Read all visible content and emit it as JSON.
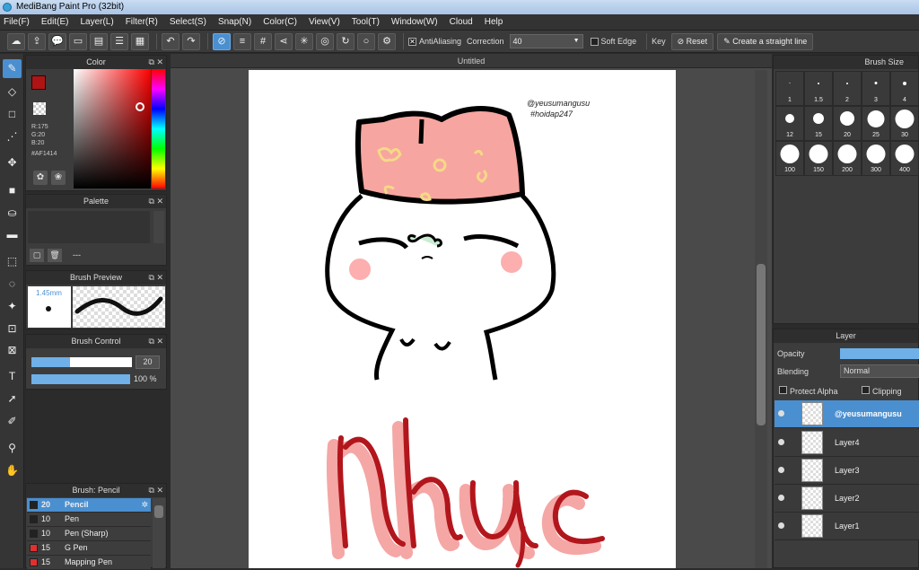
{
  "window": {
    "title": "MediBang Paint Pro (32bit)"
  },
  "menu": [
    "File(F)",
    "Edit(E)",
    "Layer(L)",
    "Filter(R)",
    "Select(S)",
    "Snap(N)",
    "Color(C)",
    "View(V)",
    "Tool(T)",
    "Window(W)",
    "Cloud",
    "Help"
  ],
  "toolbar": {
    "antialiasing_label": "AntiAliasing",
    "correction_label": "Correction",
    "correction_value": "40",
    "softedge_label": "Soft Edge",
    "key_label": "Key",
    "reset_label": "Reset",
    "straight_line_label": "Create a straight line"
  },
  "color_panel": {
    "title": "Color",
    "r": "R:175",
    "g": "G:20",
    "b": "B:20",
    "hex": "#AF1414",
    "fg_color": "#AF1414"
  },
  "palette_panel": {
    "title": "Palette",
    "value": "---"
  },
  "brush_preview": {
    "title": "Brush Preview",
    "size": "1.45mm"
  },
  "brush_control": {
    "title": "Brush Control",
    "size_value": "20",
    "opacity_value": "100",
    "opacity_unit": "%",
    "size_fraction": 0.38,
    "opacity_fraction": 1.0
  },
  "brush_list": {
    "title": "Brush: Pencil",
    "items": [
      {
        "size": "20",
        "name": "Pencil",
        "color": "#222222"
      },
      {
        "size": "10",
        "name": "Pen",
        "color": "#222222"
      },
      {
        "size": "10",
        "name": "Pen (Sharp)",
        "color": "#222222"
      },
      {
        "size": "15",
        "name": "G Pen",
        "color": "#e03030"
      },
      {
        "size": "15",
        "name": "Mapping Pen",
        "color": "#e03030"
      }
    ]
  },
  "document": {
    "title": "Untitled",
    "watermark_line1": "@yeusumangusu",
    "watermark_line2": "#hoidap247",
    "lettering": "Nhục"
  },
  "brush_size_panel": {
    "title": "Brush Size",
    "sizes": [
      "1",
      "1.5",
      "2",
      "3",
      "4",
      "12",
      "15",
      "20",
      "25",
      "30",
      "100",
      "150",
      "200",
      "300",
      "400"
    ]
  },
  "layer_panel": {
    "title": "Layer",
    "opacity_label": "Opacity",
    "blending_label": "Blending",
    "blending_value": "Normal",
    "protect_alpha_label": "Protect Alpha",
    "clipping_label": "Clipping",
    "layers": [
      "@yeusumangusu",
      "Layer4",
      "Layer3",
      "Layer2",
      "Layer1"
    ]
  }
}
